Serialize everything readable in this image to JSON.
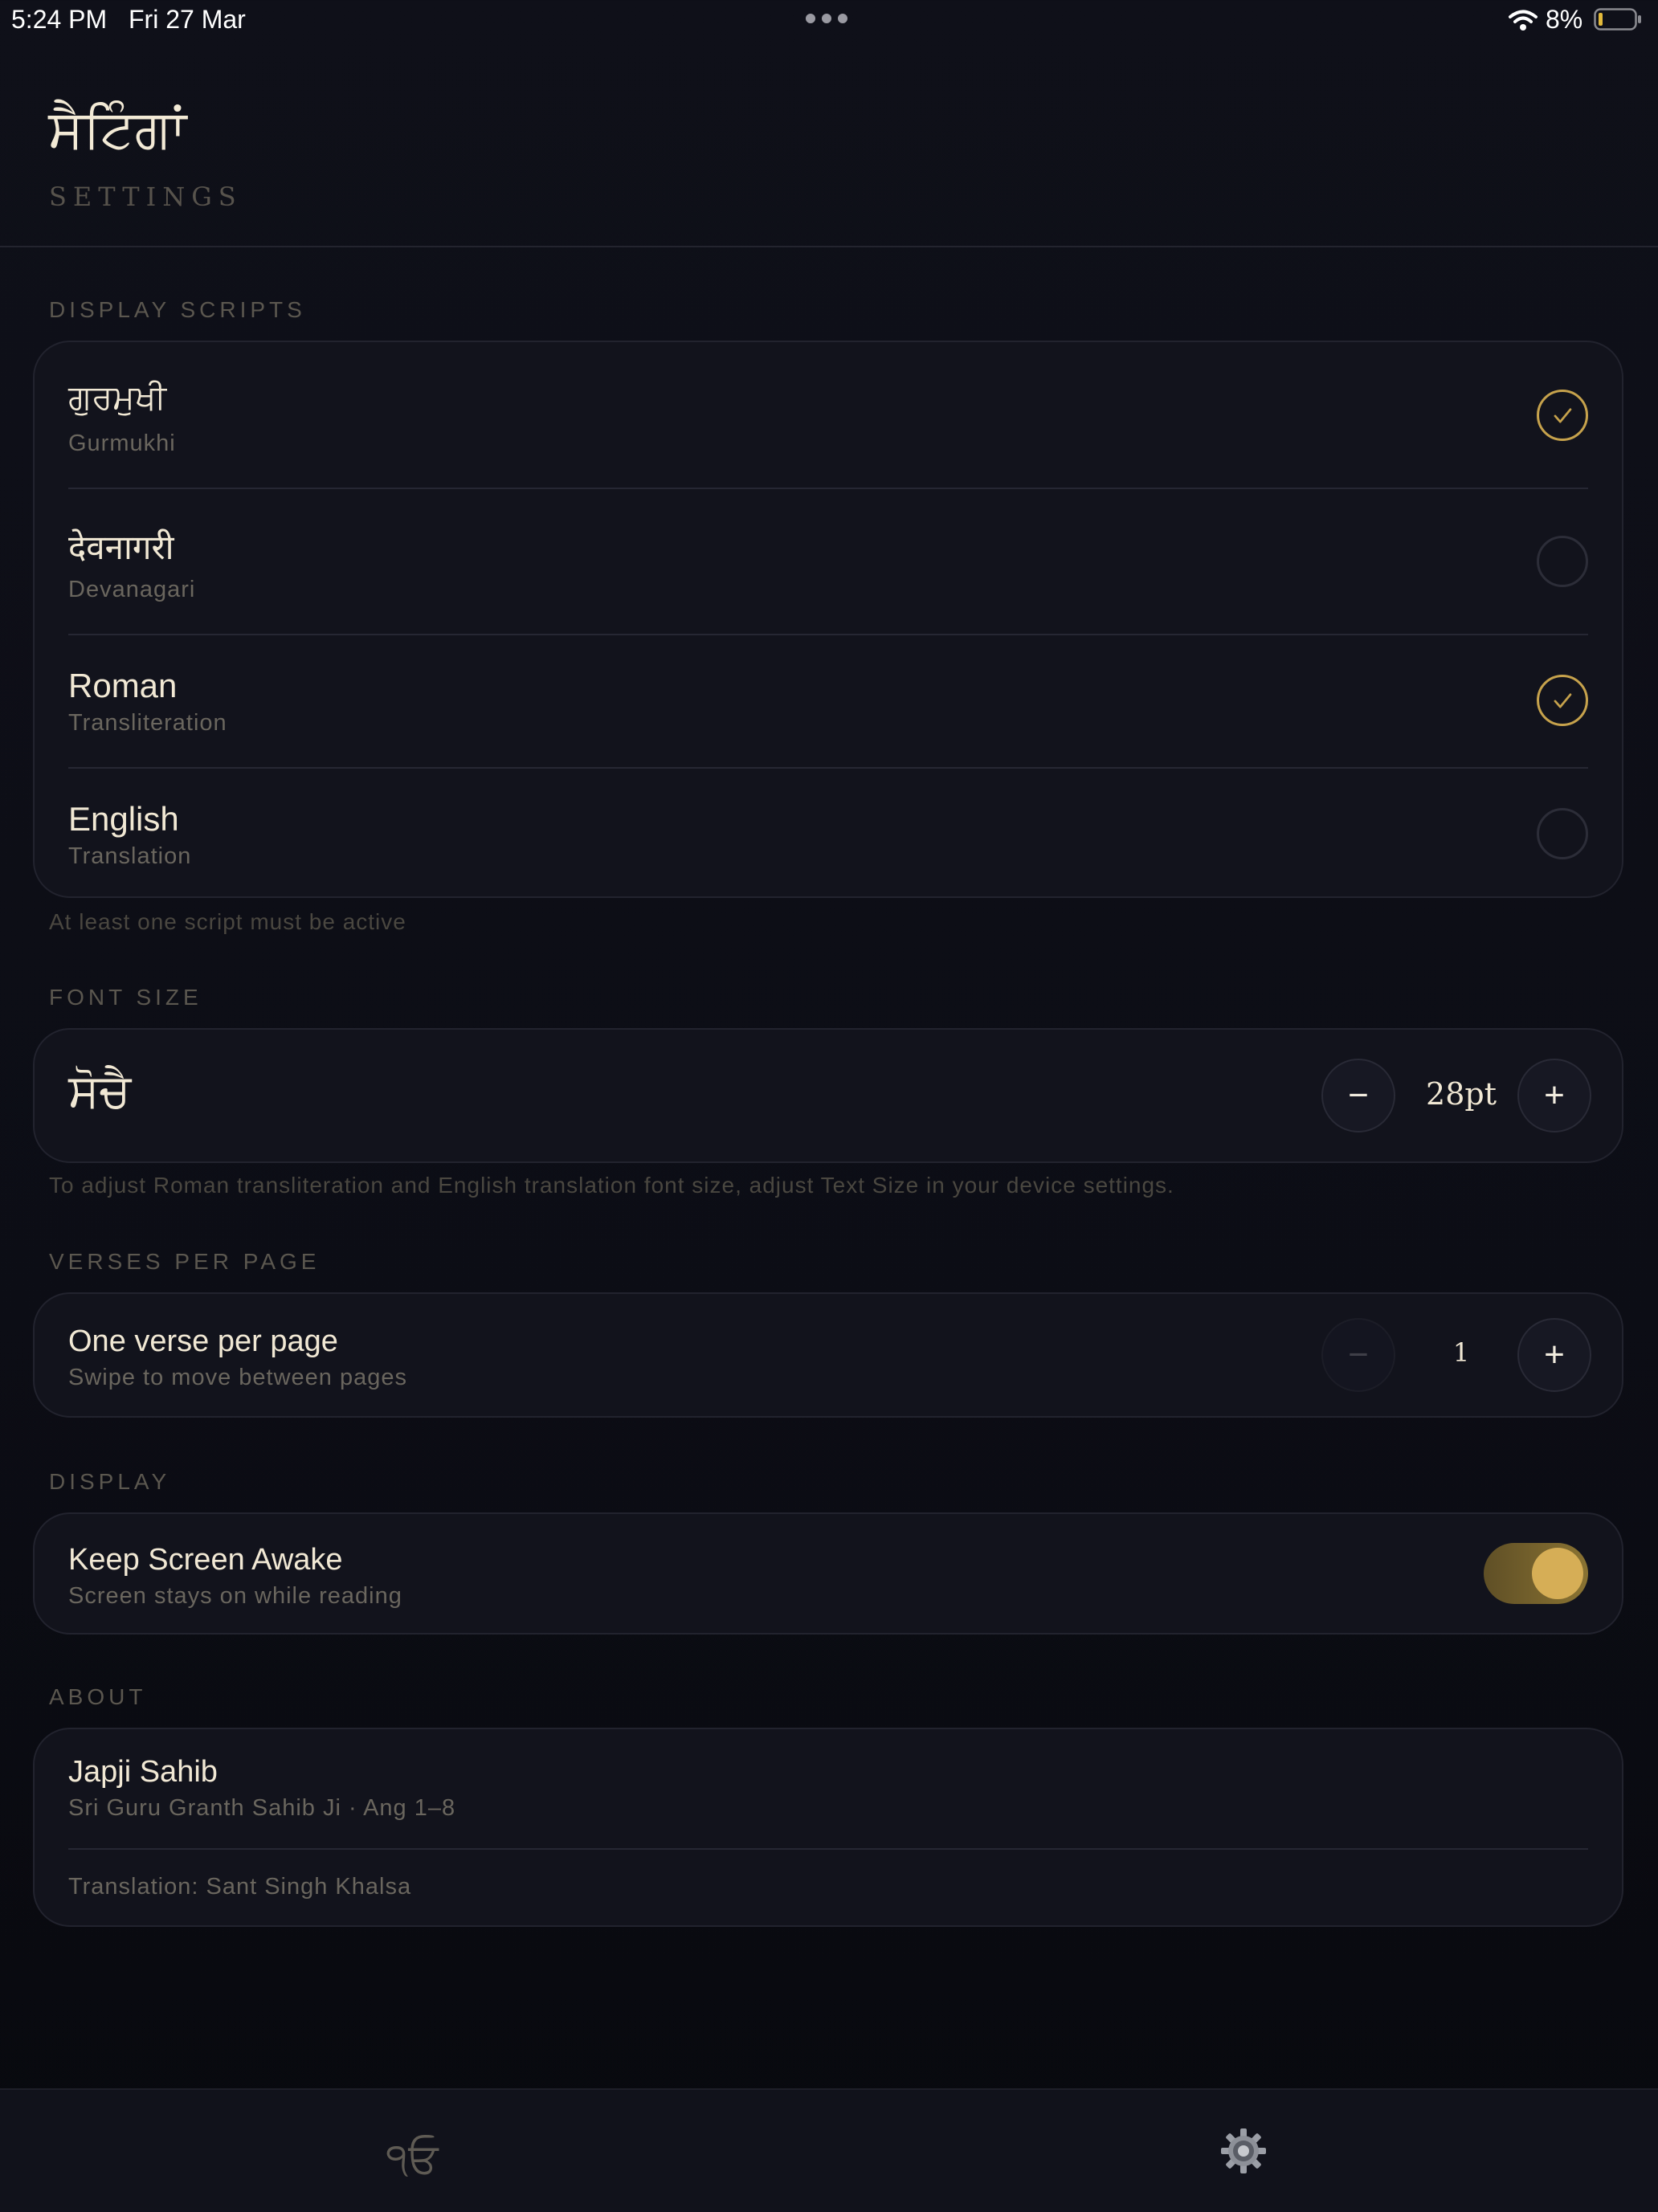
{
  "status_bar": {
    "time": "5:24 PM",
    "date": "Fri 27 Mar",
    "battery": "8%"
  },
  "header": {
    "title": "ਸੈਟਿੰਗਾਂ",
    "subtitle": "SETTINGS"
  },
  "display_scripts": {
    "label": "DISPLAY SCRIPTS",
    "options": [
      {
        "title": "ਗੁਰਮੁਖੀ",
        "subtitle": "Gurmukhi",
        "selected": true
      },
      {
        "title": "देवनागरी",
        "subtitle": "Devanagari",
        "selected": false
      },
      {
        "title": "Roman",
        "subtitle": "Transliteration",
        "selected": true
      },
      {
        "title": "English",
        "subtitle": "Translation",
        "selected": false
      }
    ],
    "helper": "At least one script must be active"
  },
  "font_size": {
    "label": "FONT SIZE",
    "preview": "ਸੋਚੈ",
    "value": "28pt",
    "decrement": "−",
    "increment": "+",
    "helper": "To adjust Roman transliteration and English translation font size, adjust Text Size in your device settings."
  },
  "verses": {
    "label": "VERSES PER PAGE",
    "title": "One verse per page",
    "subtitle": "Swipe to move between pages",
    "value": "1",
    "decrement": "−",
    "increment": "+"
  },
  "display": {
    "label": "DISPLAY",
    "title": "Keep Screen Awake",
    "subtitle": "Screen stays on while reading",
    "toggle_on": true
  },
  "about": {
    "label": "ABOUT",
    "title": "Japji Sahib",
    "subtitle": "Sri Guru Granth Sahib Ji · Ang 1–8",
    "translation": "Translation: Sant Singh Khalsa"
  },
  "tab_bar": {
    "home_label": "੧ਓ",
    "settings_icon": "gear-icon"
  },
  "colors": {
    "accent": "#c6a24c",
    "background": "#0f1019",
    "card": "#12131c"
  }
}
